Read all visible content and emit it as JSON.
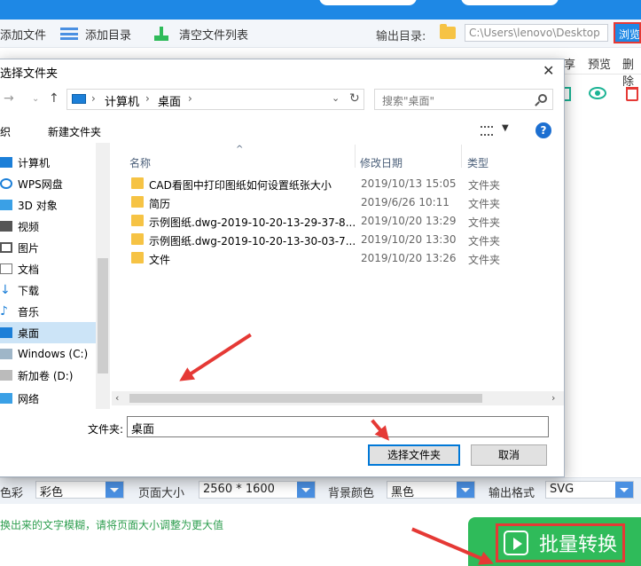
{
  "app": {
    "toolbar": {
      "add_file": "添加文件",
      "add_dir": "添加目录",
      "clear_list": "清空文件列表",
      "output_dir_label": "输出目录:",
      "output_path": "C:\\Users\\lenovo\\Desktop",
      "browse": "浏览"
    },
    "list_header": {
      "col_share": "享",
      "col_preview": "预览",
      "col_delete": "删除"
    },
    "bottom": {
      "color_label": "色彩",
      "color_value": "彩色",
      "page_size_label": "页面大小",
      "page_size_value": "2560 * 1600",
      "bg_color_label": "背景颜色",
      "bg_color_value": "黑色",
      "output_format_label": "输出格式",
      "output_format_value": "SVG",
      "hint": "换出来的文字模糊，请将页面大小调整为更大值",
      "convert_button": "批量转换"
    }
  },
  "dialog": {
    "title": "选择文件夹",
    "close": "✕",
    "address": {
      "segments": [
        "计算机",
        "桌面"
      ]
    },
    "search_placeholder": "搜索\"桌面\"",
    "commands": {
      "organize": "织",
      "new_folder": "新建文件夹"
    },
    "nav_items": [
      {
        "label": "计算机",
        "icon": "computer-icon"
      },
      {
        "label": "WPS网盘",
        "icon": "cloud-icon"
      },
      {
        "label": "3D 对象",
        "icon": "cube-icon"
      },
      {
        "label": "视频",
        "icon": "video-icon"
      },
      {
        "label": "图片",
        "icon": "picture-icon"
      },
      {
        "label": "文档",
        "icon": "document-icon"
      },
      {
        "label": "下载",
        "icon": "download-icon"
      },
      {
        "label": "音乐",
        "icon": "music-icon"
      },
      {
        "label": "桌面",
        "icon": "desktop-icon",
        "selected": true
      },
      {
        "label": "Windows (C:)",
        "icon": "drive-icon"
      },
      {
        "label": "新加卷 (D:)",
        "icon": "drive-icon"
      },
      {
        "label": "网络",
        "icon": "network-icon"
      }
    ],
    "columns": {
      "name": "名称",
      "modified": "修改日期",
      "type": "类型"
    },
    "files": [
      {
        "name": "CAD看图中打印图纸如何设置纸张大小",
        "modified": "2019/10/13 15:05",
        "type": "文件夹"
      },
      {
        "name": "简历",
        "modified": "2019/6/26 10:11",
        "type": "文件夹"
      },
      {
        "name": "示例图纸.dwg-2019-10-20-13-29-37-8...",
        "modified": "2019/10/20 13:29",
        "type": "文件夹"
      },
      {
        "name": "示例图纸.dwg-2019-10-20-13-30-03-7...",
        "modified": "2019/10/20 13:30",
        "type": "文件夹"
      },
      {
        "name": "文件",
        "modified": "2019/10/20 13:26",
        "type": "文件夹"
      }
    ],
    "folder_label": "文件夹:",
    "folder_value": "桌面",
    "select_button": "选择文件夹",
    "cancel_button": "取消"
  },
  "colors": {
    "accent": "#1e88e5",
    "highlight": "#e53935",
    "convert": "#2fbb5a"
  }
}
